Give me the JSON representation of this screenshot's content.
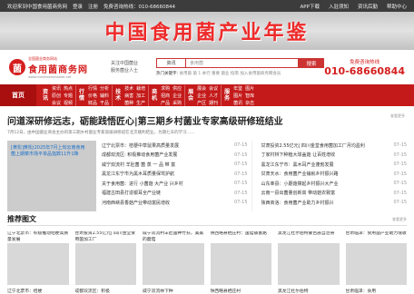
{
  "topbar": {
    "left": [
      "欢迎来到中国食用菌商务网",
      "登录",
      "注册",
      "免费咨询热线：010-68660844"
    ],
    "right": [
      "APP下载",
      "入驻须知",
      "资讯后勤",
      "帮助中心"
    ]
  },
  "banner": {
    "text": "中国食用菌产业年鉴"
  },
  "header": {
    "logo_mark": "菌",
    "logo_sub": "全国菌业商务网站",
    "logo_main": "食用菌商务网",
    "logo_url": "www.mushroommarket.net",
    "slogan": [
      "关注中国菌业",
      "服务菌业人士"
    ],
    "search_tab": "资讯",
    "search_placeholder": "食用菌",
    "search_button": "搜索",
    "hot_label": "热门关键字:",
    "hot_words": "食用菌 菌 1 本行 重要 菌业 指南 加入食用菌商务网会员",
    "hotline_label": "免费咨询热线",
    "hotline_number": "010-68660844"
  },
  "nav": {
    "home": "首页",
    "groups": [
      {
        "label": "资讯",
        "items": [
          "资讯",
          "热点",
          "原创",
          "专题",
          "会议",
          "视频"
        ]
      },
      {
        "label": "行情",
        "items": [
          "行情",
          "分析",
          "价格",
          "辅料",
          "鲜品",
          "干品"
        ]
      },
      {
        "label": "技术",
        "items": [
          "技术",
          "栽培",
          "病害",
          "加工",
          "菌种",
          "生产"
        ]
      },
      {
        "label": "商机",
        "items": [
          "求购",
          "供应",
          "招商",
          "企业",
          "产品",
          "采购"
        ]
      },
      {
        "label": "展会",
        "items": [
          "展会",
          "会议",
          "企业",
          "人才",
          "产区",
          "期刊"
        ]
      },
      {
        "label": "服务",
        "items": [
          "年鉴",
          "图片",
          "图片",
          "智库",
          "菌讯",
          "杂志"
        ]
      }
    ]
  },
  "headline": {
    "title": "问道深研修远志，砺能践悟匠心|第三期乡村菌业专家高级研修班结业",
    "summary": "7月12日，由中国菌业商会主办的第三期乡村菌业专家高级研修班在北京顺利结业，为期七天的学习……",
    "more": "查看更多"
  },
  "feature": {
    "caption": "[黄松]黄松|2025年7月上旬云南食用菌上期菜市场平单品指数11升1降"
  },
  "news_left": [
    {
      "title": "辽宁北票市：桔梗中草鼠果高质量发展",
      "date": "07-15"
    },
    {
      "title": "成都双流区: 积极推动食用菌产业发展",
      "date": "07-15"
    },
    {
      "title": "威宁双流村 羊肚菌 菌 蒸 一 品 带 富",
      "date": "07-15"
    },
    {
      "title": "黑龙江东宁市为黑木耳质量保驾护航",
      "date": "07-15"
    },
    {
      "title": "关于食用菌：进行 小菌菇 大产业 兴乡村",
      "date": "07-15"
    },
    {
      "title": "福建古田县打造银耳全产业链",
      "date": "07-15"
    },
    {
      "title": "河南西峡县香菇产业带动富民增收",
      "date": "07-15"
    }
  ],
  "news_right": [
    {
      "title": "甘肃投资2.55亿元| 四川金堂食用菌加工厂月均盈利",
      "date": "07-15"
    },
    {
      "title": "丁家村林下种植大球盖菇 让百姓增收",
      "date": "07-15"
    },
    {
      "title": "黑龙江东宁市：黑木耳产业蓬勃发展",
      "date": "07-15"
    },
    {
      "title": "甘肃天水：食用菌产业铺就乡村振兴路",
      "date": "07-15"
    },
    {
      "title": "山东莘县：小蘑菇撑起乡村振兴大产业",
      "date": "07-15"
    },
    {
      "title": "云南一县出菌量创新高 带动菇农致富",
      "date": "07-15"
    },
    {
      "title": "陕西商洛：食用菌产业助力乡村振兴",
      "date": "07-15"
    }
  ],
  "recommend": {
    "title": "推荐图文",
    "more": "查看更多",
    "items": [
      {
        "caption": "辽宁北票市：积极推动桔梗高质量发展",
        "caption2": "辽宁北票市：桔梗"
      },
      {
        "caption": "甘肃投资2.55亿元| 四川金堂食用菌加工厂",
        "caption2": "成都双流区：积极"
      },
      {
        "caption": "威宁双流村羊肚菌种竹荪，美美的蘑菇",
        "caption2": "威宁双流林下种"
      },
      {
        "caption": "陕西略县栖庄村：菌菇铺富路",
        "caption2": "陕西略县栖庄村"
      },
      {
        "caption": "黑龙江杜尔伯特蒙古族自治县",
        "caption2": "黑龙江杜尔伯特"
      },
      {
        "caption": "甘肃临泽：食用菌产业助力增收",
        "caption2": "甘肃临泽：食用"
      }
    ]
  }
}
